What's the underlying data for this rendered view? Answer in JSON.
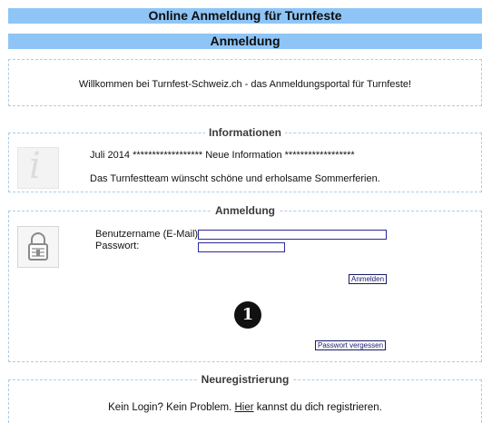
{
  "header": {
    "title": "Online Anmeldung für Turnfeste",
    "subtitle": "Anmeldung"
  },
  "welcome": {
    "text": "Willkommen bei Turnfest-Schweiz.ch - das Anmeldungsportal für Turnfeste!"
  },
  "informationen": {
    "legend": "Informationen",
    "icon": "info-icon",
    "line1": "Juli 2014 ****************** Neue Information ******************",
    "line2": "Das Turnfestteam wünscht schöne und erholsame Sommerferien."
  },
  "login": {
    "legend": "Anmeldung",
    "icon": "lock-icon",
    "username_label": "Benutzername (E-Mail):",
    "password_label": "Passwort:",
    "username_value": "",
    "password_value": "",
    "submit_label": "Anmelden",
    "forgot_label": "Passwort vergessen",
    "badge": "1"
  },
  "register": {
    "legend": "Neuregistrierung",
    "text_before": "Kein Login? Kein Problem. ",
    "link_label": "Hier",
    "text_after": " kannst du dich registrieren."
  },
  "colors": {
    "header_bg": "#8ec5f6",
    "box_border": "#a9cde9",
    "input_border": "#2a2a9a"
  }
}
